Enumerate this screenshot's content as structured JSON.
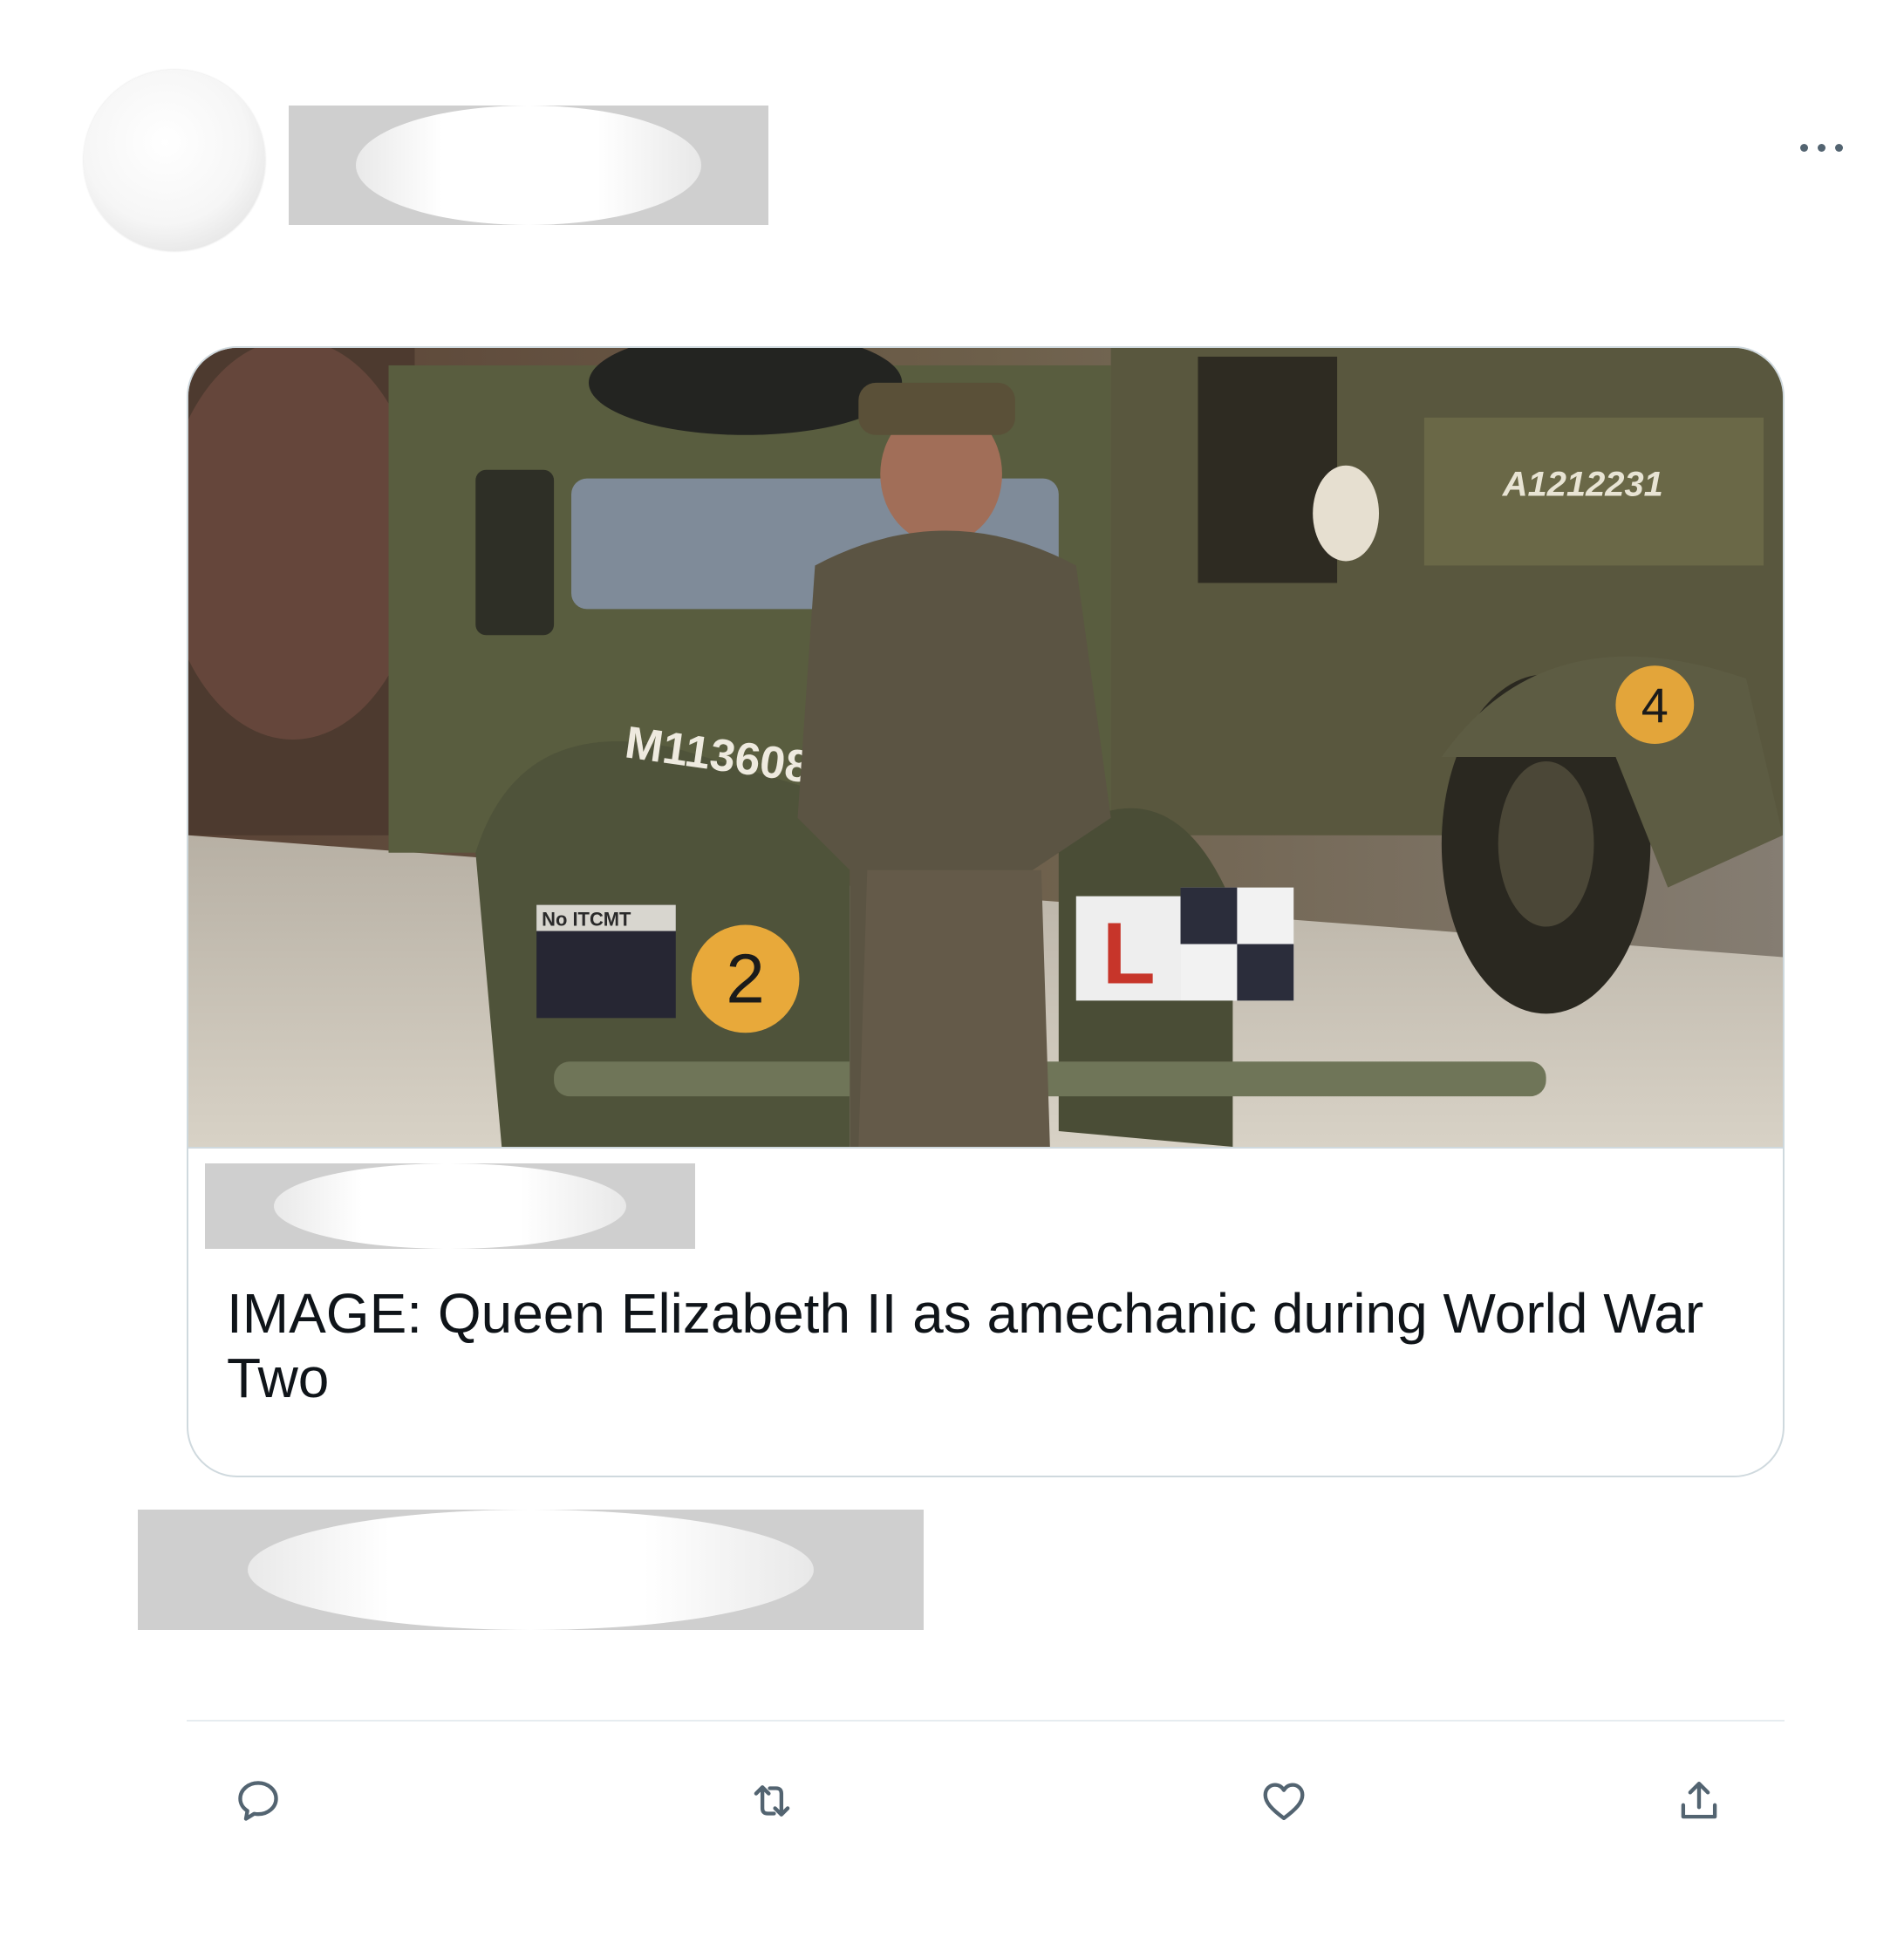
{
  "tweet": {
    "card": {
      "title": "IMAGE: Queen Elizabeth II as amechanic during World War Two",
      "image_plates": {
        "truck_serial": "M1136086",
        "fender_stencil": "No ITCMT",
        "number_left": "2",
        "number_right": "4",
        "learner_plate": "L",
        "rear_truck_serial": "A1212231"
      }
    },
    "actions": {
      "reply_icon": "reply-icon",
      "retweet_icon": "retweet-icon",
      "like_icon": "heart-icon",
      "share_icon": "share-icon"
    },
    "colors": {
      "icon": "#536471",
      "divider": "#e6ecf0",
      "card_border": "#cfd9de"
    }
  }
}
